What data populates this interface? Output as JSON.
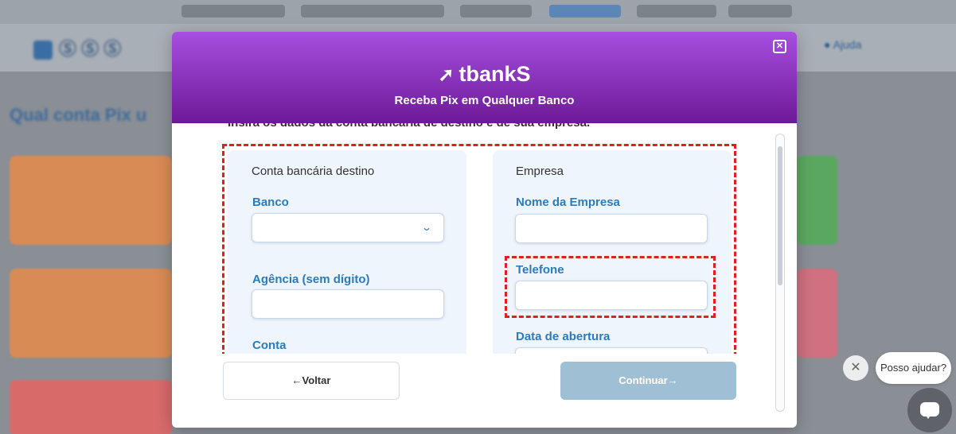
{
  "background": {
    "logo_text": "Ⓢ Ⓢ Ⓢ",
    "help_text": "● Ajuda",
    "page_title": "Qual conta Pix u"
  },
  "modal": {
    "brand": "tbankS",
    "subtitle": "Receba Pix em Qualquer Banco",
    "close_icon": "close-icon",
    "intro_text": "Insira os dados da conta bancária de destino e de sua empresa.",
    "bank_panel": {
      "title": "Conta bancária destino",
      "bank_label": "Banco",
      "bank_value": "",
      "agency_label": "Agência (sem dígito)",
      "agency_value": "",
      "account_label": "Conta"
    },
    "company_panel": {
      "title": "Empresa",
      "company_name_label": "Nome da Empresa",
      "company_name_value": "",
      "phone_label": "Telefone",
      "phone_value": "",
      "opening_date_label": "Data de abertura"
    },
    "back_button": "←Voltar",
    "continue_button": "Continuar→"
  },
  "chat": {
    "close_label": "✕",
    "bubble_text": "Posso ajudar?"
  },
  "colors": {
    "header_top": "#a64fe0",
    "header_bottom": "#6d1a97",
    "label_blue": "#2b7bc0",
    "panel_bg": "#eef5fc",
    "highlight_red": "#e02020",
    "continue_disabled": "#9fc0d4"
  }
}
